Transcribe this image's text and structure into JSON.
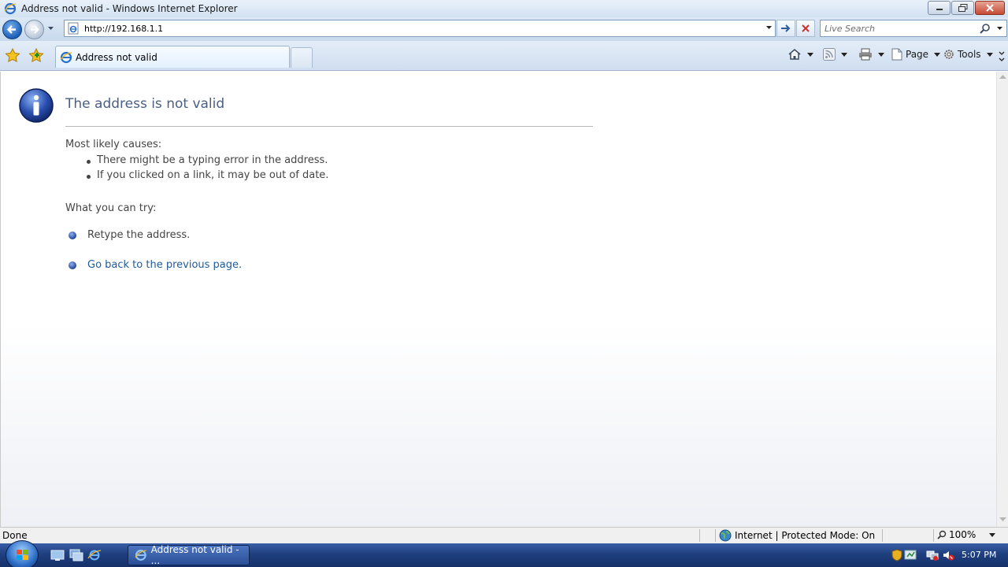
{
  "window": {
    "title": "Address not valid - Windows Internet Explorer"
  },
  "navbar": {
    "address_value": "http://192.168.1.1",
    "search_placeholder": "Live Search"
  },
  "tabs": [
    {
      "label": "Address not valid"
    }
  ],
  "command_bar": {
    "page_label": "Page",
    "tools_label": "Tools"
  },
  "error_page": {
    "title": "The address is not valid",
    "causes_heading": "Most likely causes:",
    "causes": [
      "There might be a typing error in the address.",
      "If you clicked on a link, it may be out of date."
    ],
    "try_heading": "What you can try:",
    "retype": "Retype the address.",
    "go_back": "Go back to the previous page."
  },
  "statusbar": {
    "status": "Done",
    "zone": "Internet | Protected Mode: On",
    "zoom": "100%"
  },
  "taskbar": {
    "task_label": "Address not valid - ...",
    "clock": "5:07 PM"
  },
  "colors": {
    "accent_blue": "#1f5b9a",
    "title_text": "#4a5f84"
  }
}
